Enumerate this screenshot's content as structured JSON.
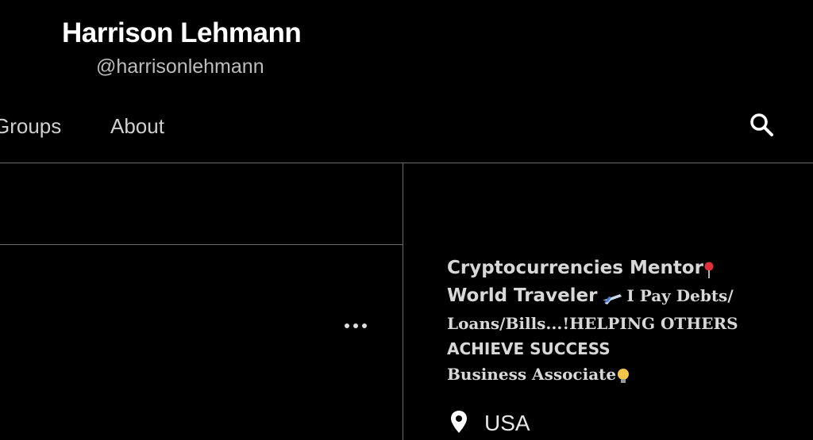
{
  "profile": {
    "name": "Harrison Lehmann",
    "handle": "@harrisonlehmann"
  },
  "nav": {
    "tabs": [
      {
        "label": "Groups"
      },
      {
        "label": "About"
      }
    ],
    "search_icon": "search-icon"
  },
  "post": {
    "more_icon": "more-options-icon"
  },
  "bio": {
    "line1": "Cryptocurrencies Mentor",
    "line2a": "World Traveler",
    "line2b": "I Pay Debts/",
    "line3": "Loans/Bills...!HELPING OTHERS",
    "line4": "ACHIEVE SUCCESS",
    "line5": "Business Associate",
    "emoji_icons": [
      "pin-icon",
      "airplane-icon",
      "lightbulb-icon"
    ]
  },
  "location": {
    "icon": "location-pin-icon",
    "text": "USA"
  },
  "colors": {
    "background": "#000000",
    "divider": "#6b6b6b",
    "text_primary": "#ffffff",
    "text_secondary": "#bdbdbd"
  }
}
